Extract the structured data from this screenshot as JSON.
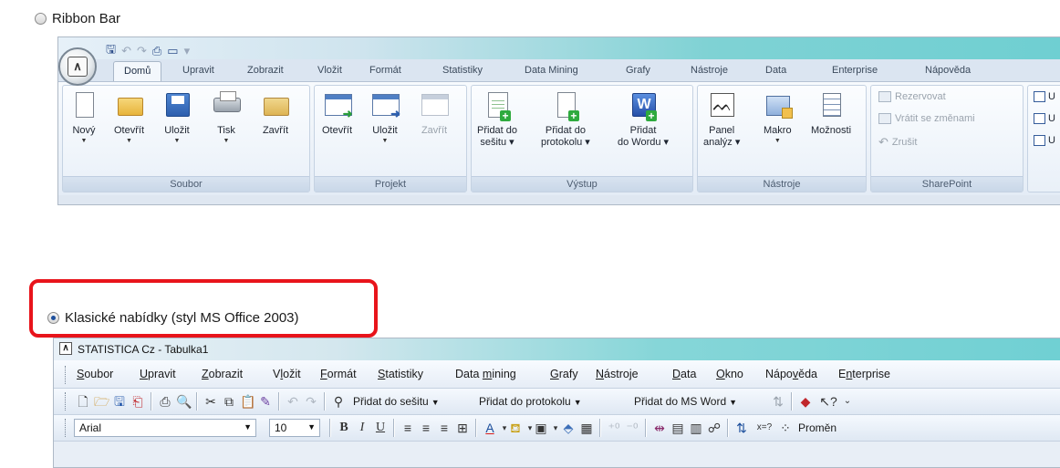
{
  "options": {
    "ribbon_label": "Ribbon Bar",
    "ribbon_selected": false,
    "classic_label": "Klasické nabídky (styl MS Office 2003)",
    "classic_selected": true
  },
  "ribbon": {
    "tabs": [
      "Domů",
      "Upravit",
      "Zobrazit",
      "Vložit",
      "Formát",
      "Statistiky",
      "Data Mining",
      "Grafy",
      "Nástroje",
      "Data",
      "Enterprise",
      "Nápověda"
    ],
    "active_tab": "Domů",
    "groups": {
      "soubor": {
        "label": "Soubor",
        "buttons": [
          "Nový",
          "Otevřít",
          "Uložit",
          "Tisk",
          "Zavřít"
        ]
      },
      "projekt": {
        "label": "Projekt",
        "buttons": [
          "Otevřít",
          "Uložit",
          "Zavřít"
        ]
      },
      "vystup": {
        "label": "Výstup",
        "buttons": [
          {
            "line1": "Přidat do",
            "line2": "sešitu ▾"
          },
          {
            "line1": "Přidat do",
            "line2": "protokolu ▾"
          },
          {
            "line1": "Přidat",
            "line2": "do Wordu ▾"
          }
        ]
      },
      "nastroje": {
        "label": "Nástroje",
        "buttons": [
          {
            "line1": "Panel",
            "line2": "analýz ▾"
          },
          {
            "line1": "Makro",
            "line2": ""
          },
          {
            "line1": "Možnosti",
            "line2": ""
          }
        ]
      },
      "sharepoint": {
        "label": "SharePoint",
        "items": [
          "Rezervovat",
          "Vrátit se změnami",
          "Zrušit"
        ]
      },
      "partial": {
        "items": [
          "U",
          "U",
          "U"
        ]
      }
    }
  },
  "classic": {
    "window_title": "STATISTICA Cz - Tabulka1",
    "menu": [
      {
        "pre": "",
        "u": "S",
        "post": "oubor"
      },
      {
        "pre": "",
        "u": "U",
        "post": "pravit"
      },
      {
        "pre": "",
        "u": "Z",
        "post": "obrazit"
      },
      {
        "pre": "V",
        "u": "l",
        "post": "ožit"
      },
      {
        "pre": "",
        "u": "F",
        "post": "ormát"
      },
      {
        "pre": "",
        "u": "S",
        "post": "tatistiky"
      },
      {
        "pre": "Data ",
        "u": "m",
        "post": "ining"
      },
      {
        "pre": "",
        "u": "G",
        "post": "rafy"
      },
      {
        "pre": "",
        "u": "N",
        "post": "ástroje"
      },
      {
        "pre": "",
        "u": "D",
        "post": "ata"
      },
      {
        "pre": "",
        "u": "O",
        "post": "kno"
      },
      {
        "pre": "Nápo",
        "u": "v",
        "post": "ěda"
      },
      {
        "pre": "E",
        "u": "n",
        "post": "terprise"
      }
    ],
    "toolbar1": {
      "add_workbook": "Přidat do sešitu",
      "add_report": "Přidat do protokolu",
      "add_word": "Přidat do MS Word"
    },
    "toolbar2": {
      "font": "Arial",
      "size": "10",
      "bold": "B",
      "italic": "I",
      "underline": "U",
      "variables": "Proměn"
    }
  },
  "colors": {
    "highlight": "#e8141b",
    "title_accent": "#70d0d3"
  }
}
